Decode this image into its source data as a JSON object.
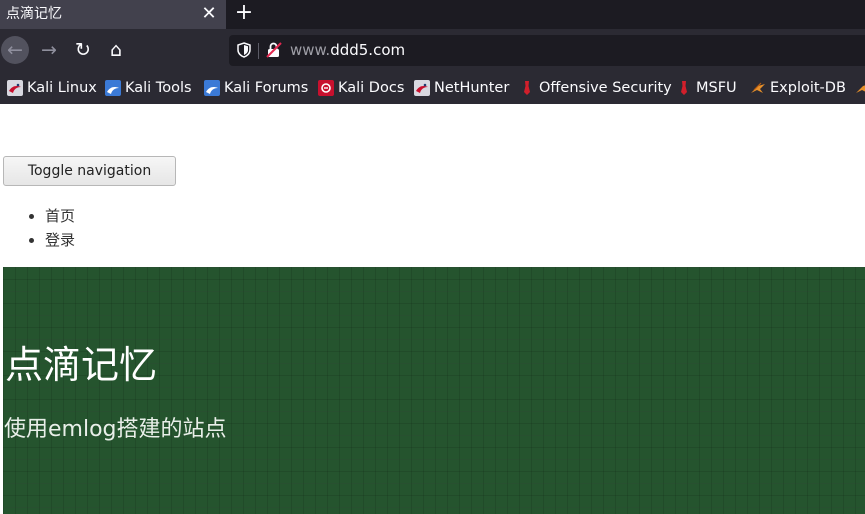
{
  "browser": {
    "tab": {
      "title": "点滴记忆",
      "close_glyph": "✕"
    },
    "new_tab_glyph": "+",
    "nav": {
      "back_glyph": "←",
      "forward_glyph": "→",
      "reload_glyph": "↻",
      "home_glyph": "⌂"
    },
    "url": {
      "prefix": "www.",
      "domain": "ddd5.com"
    },
    "bookmarks": [
      {
        "label": "Kali Linux",
        "icon": "kali-dragon-icon"
      },
      {
        "label": "Kali Tools",
        "icon": "kali-dragon-icon"
      },
      {
        "label": "Kali Forums",
        "icon": "kali-dragon-icon"
      },
      {
        "label": "Kali Docs",
        "icon": "kali-docs-icon"
      },
      {
        "label": "NetHunter",
        "icon": "kali-dragon-icon"
      },
      {
        "label": "Offensive Security",
        "icon": "offsec-icon"
      },
      {
        "label": "MSFU",
        "icon": "offsec-icon"
      },
      {
        "label": "Exploit-DB",
        "icon": "exploit-db-icon"
      }
    ],
    "colors": {
      "tab_active": "#42414d",
      "toolbar": "#2b2a33",
      "urlbar": "#1c1b22"
    }
  },
  "page": {
    "toggle_button": "Toggle navigation",
    "nav_items": [
      {
        "label": "首页"
      },
      {
        "label": "登录"
      }
    ],
    "hero": {
      "title": "点滴记忆",
      "subtitle": "使用emlog搭建的站点"
    },
    "colors": {
      "hero_bg": "#25542e"
    }
  }
}
